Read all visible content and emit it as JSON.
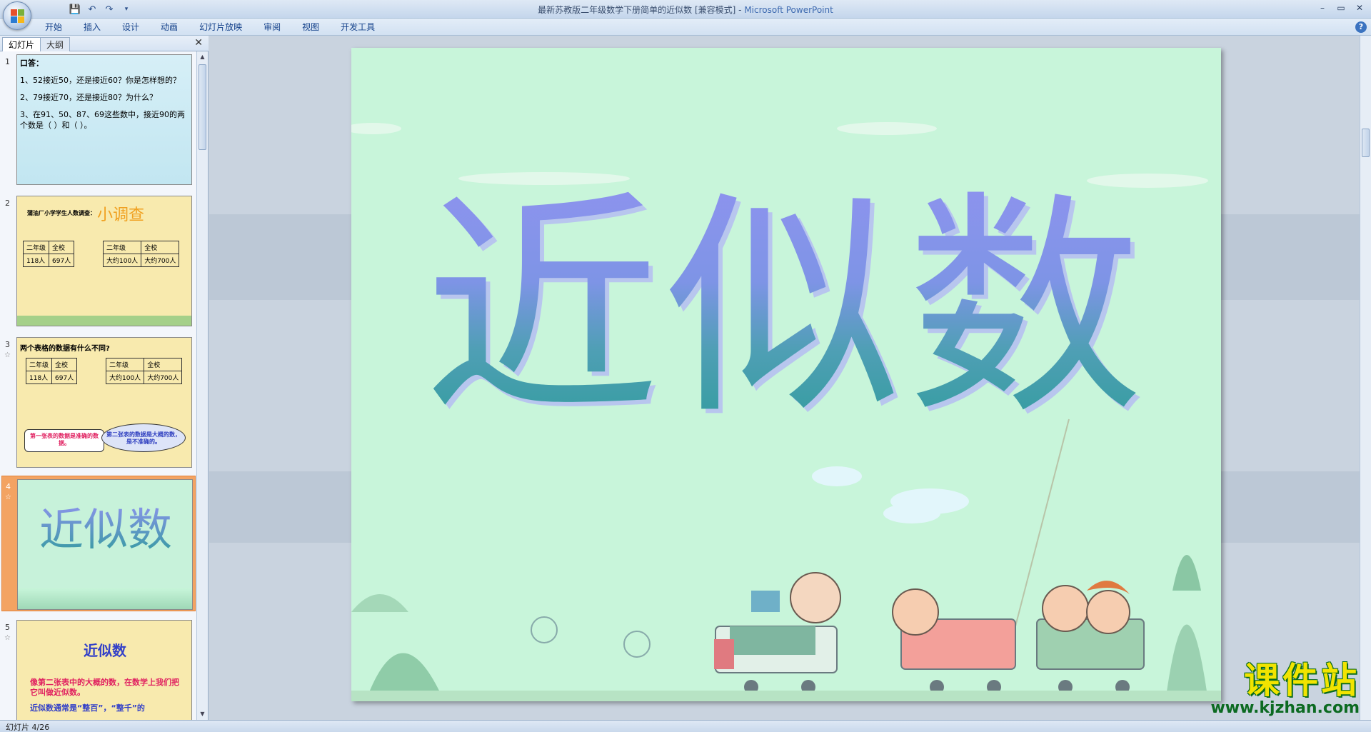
{
  "window": {
    "title": "最新苏教版二年级数学下册简单的近似数 [兼容模式]",
    "separator": " - ",
    "app_name": "Microsoft PowerPoint",
    "min": "–",
    "max": "▭",
    "close": "✕"
  },
  "qat": {
    "save": "💾",
    "undo": "↶",
    "redo": "↷",
    "more": "▾"
  },
  "ribbon": {
    "tabs": [
      "开始",
      "插入",
      "设计",
      "动画",
      "幻灯片放映",
      "审阅",
      "视图",
      "开发工具"
    ],
    "help": "?"
  },
  "left_pane": {
    "tab_slides": "幻灯片",
    "tab_outline": "大纲",
    "close": "✕"
  },
  "thumbnails": [
    {
      "num": "1",
      "head": "口答：",
      "lines": [
        "1、52接近50，还是接近60？你是怎样想的？",
        "2、79接近70，还是接近80？为什么？",
        "3、在91、50、87、69这些数中，接近90的两个数是（ ）和（ ）。"
      ]
    },
    {
      "num": "2",
      "survey_label": "蒲油厂小学学生人数调查：",
      "survey_title": "小调查",
      "table1": [
        [
          "二年级",
          "全校"
        ],
        [
          "118人",
          "697人"
        ]
      ],
      "table2": [
        [
          "二年级",
          "全校"
        ],
        [
          "大约100人",
          "大约700人"
        ]
      ]
    },
    {
      "num": "3",
      "star": "☆",
      "question": "两个表格的数据有什么不同?",
      "table1": [
        [
          "二年级",
          "全校"
        ],
        [
          "118人",
          "697人"
        ]
      ],
      "table2": [
        [
          "二年级",
          "全校"
        ],
        [
          "大约100人",
          "大约700人"
        ]
      ],
      "bubble1": "第一张表的数据是准确的数据。",
      "bubble2": "第二张表的数据是大概的数，是不准确的。"
    },
    {
      "num": "4",
      "star": "☆",
      "title": "近似数"
    },
    {
      "num": "5",
      "star": "☆",
      "title": "近似数",
      "line1": "像第二张表中的大概的数，在数学上我们把它叫做近似数。",
      "line2": "近似数通常是“整百”，“整千”的"
    }
  ],
  "slide": {
    "title": "近似数"
  },
  "status": {
    "slide_indicator": "幻灯片 4/26"
  },
  "watermark": {
    "name": "课件站",
    "url": "www.kjzhan.com"
  },
  "colors": {
    "slide_bg": "#c8f5da",
    "selected_thumb": "#f3a362",
    "title_top": "#8f93ef",
    "title_bottom": "#2e9c9a"
  }
}
